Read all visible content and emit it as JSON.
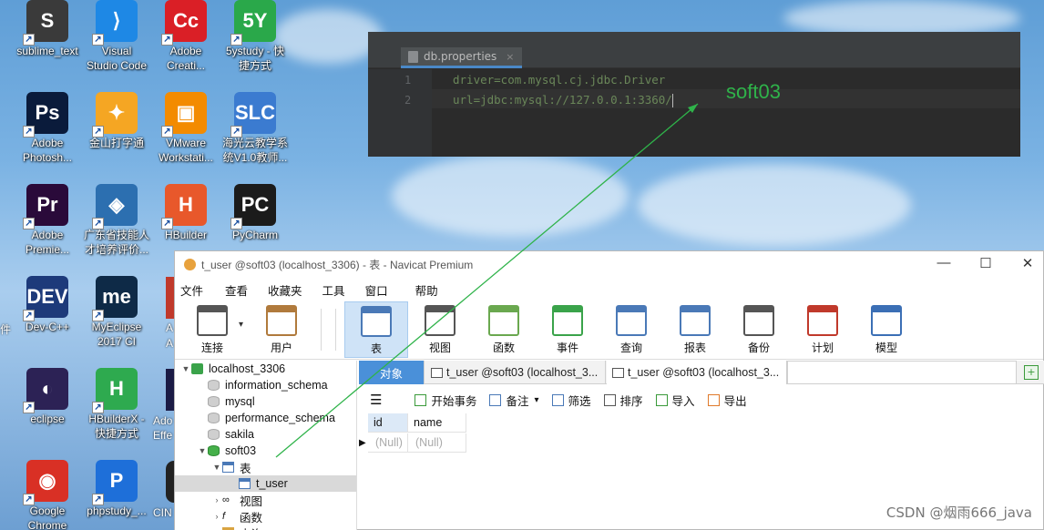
{
  "desktop": {
    "icons": [
      {
        "label": "sublime_text",
        "glyph": "S",
        "color": "#3a3a3a",
        "icon": "sublime-icon"
      },
      {
        "label": "Visual\nStudio Code",
        "glyph": "⟩",
        "color": "#1e88e5",
        "icon": "vscode-icon"
      },
      {
        "label": "Adobe\nCreati...",
        "glyph": "Cc",
        "color": "#da1f26",
        "icon": "adobe-cc-icon"
      },
      {
        "label": "5ystudy - 快\n捷方式",
        "glyph": "5Y",
        "color": "#2aa84a",
        "icon": "5ystudy-icon"
      },
      {
        "label": "Adobe\nPhotosh...",
        "glyph": "Ps",
        "color": "#0a1b3b",
        "icon": "photoshop-icon"
      },
      {
        "label": "金山打字通",
        "glyph": "✦",
        "color": "#f5a623",
        "icon": "kingsoft-typing-icon"
      },
      {
        "label": "VMware\nWorkstati...",
        "glyph": "▣",
        "color": "#f38b00",
        "icon": "vmware-icon"
      },
      {
        "label": "海光云教学系\n统V1.0教师...",
        "glyph": "SLC",
        "color": "#3b7bd0",
        "icon": "slc-icon"
      },
      {
        "label": "Adobe\nPremie...",
        "glyph": "Pr",
        "color": "#2a0a3a",
        "icon": "premiere-icon"
      },
      {
        "label": "广东省技能人\n才培养评价...",
        "glyph": "◈",
        "color": "#2c6fb0",
        "icon": "skills-eval-icon"
      },
      {
        "label": "HBuilder",
        "glyph": "H",
        "color": "#e8582b",
        "icon": "hbuilder-icon"
      },
      {
        "label": "PyCharm",
        "glyph": "PC",
        "color": "#1b1b1b",
        "icon": "pycharm-icon"
      },
      {
        "label": "Dev-C++",
        "glyph": "DEV",
        "color": "#1d3a7a",
        "icon": "devcpp-icon"
      },
      {
        "label": "MyEclipse\n2017 CI",
        "glyph": "me",
        "color": "#0e2a47",
        "icon": "myeclipse-icon"
      },
      {
        "label": "eclipse",
        "glyph": "◐",
        "color": "#2c2255",
        "icon": "eclipse-icon"
      },
      {
        "label": "HBuilderX -\n快捷方式",
        "glyph": "H",
        "color": "#2eaa4f",
        "icon": "hbuilderx-icon"
      },
      {
        "label": "Google\nChrome",
        "glyph": "◉",
        "color": "#d93025",
        "icon": "chrome-icon"
      },
      {
        "label": "phpstudy_...",
        "glyph": "P",
        "color": "#1e6fd9",
        "icon": "phpstudy-icon"
      }
    ],
    "partial_labels": {
      "left_edge": "件",
      "ad1": "A",
      "ad2": "A",
      "ad3": "Ado",
      "ad4": "Effe",
      "cin": "CIN"
    }
  },
  "editor": {
    "tab_label": "db.properties",
    "tab_close": "×",
    "lines": [
      {
        "num": "1",
        "text": "driver=com.mysql.cj.jdbc.Driver"
      },
      {
        "num": "2",
        "text": "url=jdbc:mysql://127.0.0.1:3360/"
      }
    ],
    "annotation": "soft03",
    "colors": {
      "bg": "#2b2b2b",
      "string": "#6a8759",
      "annotation": "#2fb34a"
    }
  },
  "navicat": {
    "title": "t_user @soft03 (localhost_3306) - 表 - Navicat Premium",
    "window_controls": {
      "minimize": "—",
      "maximize": "☐",
      "close": "✕"
    },
    "menu": [
      "文件",
      "查看",
      "收藏夹",
      "工具",
      "窗口",
      "帮助"
    ],
    "toolbar": [
      {
        "label": "连接",
        "icon": "connection-icon"
      },
      {
        "label": "用户",
        "icon": "user-icon"
      },
      {
        "label": "表",
        "icon": "table-icon",
        "active": true
      },
      {
        "label": "视图",
        "icon": "view-icon"
      },
      {
        "label": "函数",
        "icon": "function-icon"
      },
      {
        "label": "事件",
        "icon": "event-icon"
      },
      {
        "label": "查询",
        "icon": "query-icon"
      },
      {
        "label": "报表",
        "icon": "report-icon"
      },
      {
        "label": "备份",
        "icon": "backup-icon"
      },
      {
        "label": "计划",
        "icon": "schedule-icon"
      },
      {
        "label": "模型",
        "icon": "model-icon"
      }
    ],
    "tree": [
      {
        "label": "localhost_3306",
        "level": 0,
        "twisty": "▼",
        "icon": "connection"
      },
      {
        "label": "information_schema",
        "level": 1,
        "icon": "db"
      },
      {
        "label": "mysql",
        "level": 1,
        "icon": "db"
      },
      {
        "label": "performance_schema",
        "level": 1,
        "icon": "db"
      },
      {
        "label": "sakila",
        "level": 1,
        "icon": "db"
      },
      {
        "label": "soft03",
        "level": 1,
        "twisty": "▼",
        "icon": "db-open"
      },
      {
        "label": "表",
        "level": 2,
        "twisty": "▼",
        "icon": "tables"
      },
      {
        "label": "t_user",
        "level": 3,
        "icon": "table",
        "selected": true
      },
      {
        "label": "视图",
        "level": 2,
        "twisty": "›",
        "icon": "views"
      },
      {
        "label": "函数",
        "level": 2,
        "twisty": "›",
        "icon": "functions"
      },
      {
        "label": "查询",
        "level": 2,
        "twisty": "›",
        "icon": "queries"
      }
    ],
    "tabs": [
      {
        "label": "对象"
      },
      {
        "label": "t_user @soft03 (localhost_3..."
      },
      {
        "label": "t_user @soft03 (localhost_3..."
      }
    ],
    "subbar": [
      {
        "label": "开始事务",
        "icon": "begin-transaction-icon"
      },
      {
        "label": "备注",
        "icon": "memo-icon"
      },
      {
        "label": "筛选",
        "icon": "filter-icon"
      },
      {
        "label": "排序",
        "icon": "sort-icon"
      },
      {
        "label": "导入",
        "icon": "import-icon"
      },
      {
        "label": "导出",
        "icon": "export-icon"
      }
    ],
    "grid": {
      "columns": [
        "id",
        "name"
      ],
      "rows": [
        [
          "(Null)",
          "(Null)"
        ]
      ],
      "row_marker": "▶"
    }
  },
  "watermark": "CSDN @烟雨666_java"
}
